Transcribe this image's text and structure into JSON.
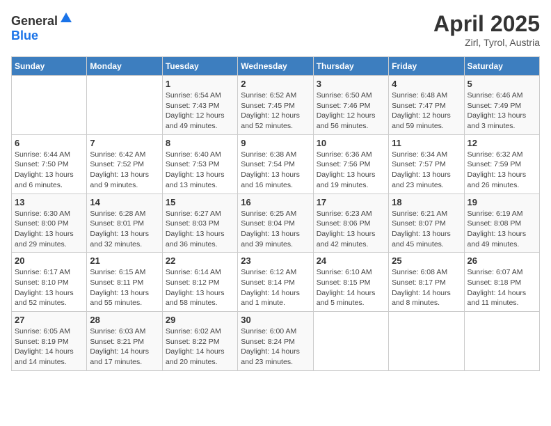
{
  "header": {
    "logo_general": "General",
    "logo_blue": "Blue",
    "title": "April 2025",
    "subtitle": "Zirl, Tyrol, Austria"
  },
  "calendar": {
    "days_of_week": [
      "Sunday",
      "Monday",
      "Tuesday",
      "Wednesday",
      "Thursday",
      "Friday",
      "Saturday"
    ],
    "weeks": [
      [
        {
          "day": "",
          "sunrise": "",
          "sunset": "",
          "daylight": ""
        },
        {
          "day": "",
          "sunrise": "",
          "sunset": "",
          "daylight": ""
        },
        {
          "day": "1",
          "sunrise": "Sunrise: 6:54 AM",
          "sunset": "Sunset: 7:43 PM",
          "daylight": "Daylight: 12 hours and 49 minutes."
        },
        {
          "day": "2",
          "sunrise": "Sunrise: 6:52 AM",
          "sunset": "Sunset: 7:45 PM",
          "daylight": "Daylight: 12 hours and 52 minutes."
        },
        {
          "day": "3",
          "sunrise": "Sunrise: 6:50 AM",
          "sunset": "Sunset: 7:46 PM",
          "daylight": "Daylight: 12 hours and 56 minutes."
        },
        {
          "day": "4",
          "sunrise": "Sunrise: 6:48 AM",
          "sunset": "Sunset: 7:47 PM",
          "daylight": "Daylight: 12 hours and 59 minutes."
        },
        {
          "day": "5",
          "sunrise": "Sunrise: 6:46 AM",
          "sunset": "Sunset: 7:49 PM",
          "daylight": "Daylight: 13 hours and 3 minutes."
        }
      ],
      [
        {
          "day": "6",
          "sunrise": "Sunrise: 6:44 AM",
          "sunset": "Sunset: 7:50 PM",
          "daylight": "Daylight: 13 hours and 6 minutes."
        },
        {
          "day": "7",
          "sunrise": "Sunrise: 6:42 AM",
          "sunset": "Sunset: 7:52 PM",
          "daylight": "Daylight: 13 hours and 9 minutes."
        },
        {
          "day": "8",
          "sunrise": "Sunrise: 6:40 AM",
          "sunset": "Sunset: 7:53 PM",
          "daylight": "Daylight: 13 hours and 13 minutes."
        },
        {
          "day": "9",
          "sunrise": "Sunrise: 6:38 AM",
          "sunset": "Sunset: 7:54 PM",
          "daylight": "Daylight: 13 hours and 16 minutes."
        },
        {
          "day": "10",
          "sunrise": "Sunrise: 6:36 AM",
          "sunset": "Sunset: 7:56 PM",
          "daylight": "Daylight: 13 hours and 19 minutes."
        },
        {
          "day": "11",
          "sunrise": "Sunrise: 6:34 AM",
          "sunset": "Sunset: 7:57 PM",
          "daylight": "Daylight: 13 hours and 23 minutes."
        },
        {
          "day": "12",
          "sunrise": "Sunrise: 6:32 AM",
          "sunset": "Sunset: 7:59 PM",
          "daylight": "Daylight: 13 hours and 26 minutes."
        }
      ],
      [
        {
          "day": "13",
          "sunrise": "Sunrise: 6:30 AM",
          "sunset": "Sunset: 8:00 PM",
          "daylight": "Daylight: 13 hours and 29 minutes."
        },
        {
          "day": "14",
          "sunrise": "Sunrise: 6:28 AM",
          "sunset": "Sunset: 8:01 PM",
          "daylight": "Daylight: 13 hours and 32 minutes."
        },
        {
          "day": "15",
          "sunrise": "Sunrise: 6:27 AM",
          "sunset": "Sunset: 8:03 PM",
          "daylight": "Daylight: 13 hours and 36 minutes."
        },
        {
          "day": "16",
          "sunrise": "Sunrise: 6:25 AM",
          "sunset": "Sunset: 8:04 PM",
          "daylight": "Daylight: 13 hours and 39 minutes."
        },
        {
          "day": "17",
          "sunrise": "Sunrise: 6:23 AM",
          "sunset": "Sunset: 8:06 PM",
          "daylight": "Daylight: 13 hours and 42 minutes."
        },
        {
          "day": "18",
          "sunrise": "Sunrise: 6:21 AM",
          "sunset": "Sunset: 8:07 PM",
          "daylight": "Daylight: 13 hours and 45 minutes."
        },
        {
          "day": "19",
          "sunrise": "Sunrise: 6:19 AM",
          "sunset": "Sunset: 8:08 PM",
          "daylight": "Daylight: 13 hours and 49 minutes."
        }
      ],
      [
        {
          "day": "20",
          "sunrise": "Sunrise: 6:17 AM",
          "sunset": "Sunset: 8:10 PM",
          "daylight": "Daylight: 13 hours and 52 minutes."
        },
        {
          "day": "21",
          "sunrise": "Sunrise: 6:15 AM",
          "sunset": "Sunset: 8:11 PM",
          "daylight": "Daylight: 13 hours and 55 minutes."
        },
        {
          "day": "22",
          "sunrise": "Sunrise: 6:14 AM",
          "sunset": "Sunset: 8:12 PM",
          "daylight": "Daylight: 13 hours and 58 minutes."
        },
        {
          "day": "23",
          "sunrise": "Sunrise: 6:12 AM",
          "sunset": "Sunset: 8:14 PM",
          "daylight": "Daylight: 14 hours and 1 minute."
        },
        {
          "day": "24",
          "sunrise": "Sunrise: 6:10 AM",
          "sunset": "Sunset: 8:15 PM",
          "daylight": "Daylight: 14 hours and 5 minutes."
        },
        {
          "day": "25",
          "sunrise": "Sunrise: 6:08 AM",
          "sunset": "Sunset: 8:17 PM",
          "daylight": "Daylight: 14 hours and 8 minutes."
        },
        {
          "day": "26",
          "sunrise": "Sunrise: 6:07 AM",
          "sunset": "Sunset: 8:18 PM",
          "daylight": "Daylight: 14 hours and 11 minutes."
        }
      ],
      [
        {
          "day": "27",
          "sunrise": "Sunrise: 6:05 AM",
          "sunset": "Sunset: 8:19 PM",
          "daylight": "Daylight: 14 hours and 14 minutes."
        },
        {
          "day": "28",
          "sunrise": "Sunrise: 6:03 AM",
          "sunset": "Sunset: 8:21 PM",
          "daylight": "Daylight: 14 hours and 17 minutes."
        },
        {
          "day": "29",
          "sunrise": "Sunrise: 6:02 AM",
          "sunset": "Sunset: 8:22 PM",
          "daylight": "Daylight: 14 hours and 20 minutes."
        },
        {
          "day": "30",
          "sunrise": "Sunrise: 6:00 AM",
          "sunset": "Sunset: 8:24 PM",
          "daylight": "Daylight: 14 hours and 23 minutes."
        },
        {
          "day": "",
          "sunrise": "",
          "sunset": "",
          "daylight": ""
        },
        {
          "day": "",
          "sunrise": "",
          "sunset": "",
          "daylight": ""
        },
        {
          "day": "",
          "sunrise": "",
          "sunset": "",
          "daylight": ""
        }
      ]
    ]
  }
}
